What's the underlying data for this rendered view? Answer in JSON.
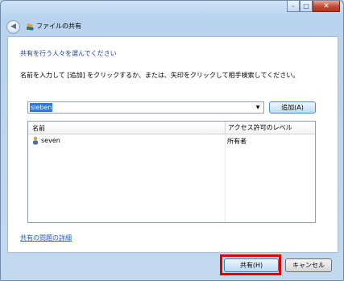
{
  "window": {
    "title": "ファイルの共有",
    "controls": {
      "minimize": "–",
      "maximize": "□",
      "close": "✕"
    }
  },
  "content": {
    "heading": "共有を行う人々を選んでください",
    "instruction": "名前を入力して [追加] をクリックするか、または、矢印をクリックして相手検索してください。",
    "name_input": {
      "value": "sieben"
    },
    "add_button": "追加(A)",
    "list": {
      "columns": [
        "名前",
        "アクセス許可のレベル"
      ],
      "rows": [
        {
          "name": "seven",
          "permission": "所有者"
        }
      ]
    },
    "details_link": "共有の問題の詳細"
  },
  "footer": {
    "share_button": "共有(H)",
    "cancel_button": "キャンセル"
  },
  "colors": {
    "heading": "#1f3f9b",
    "link": "#1d5bb8",
    "highlight": "#e00000",
    "selection": "#3077d3"
  }
}
